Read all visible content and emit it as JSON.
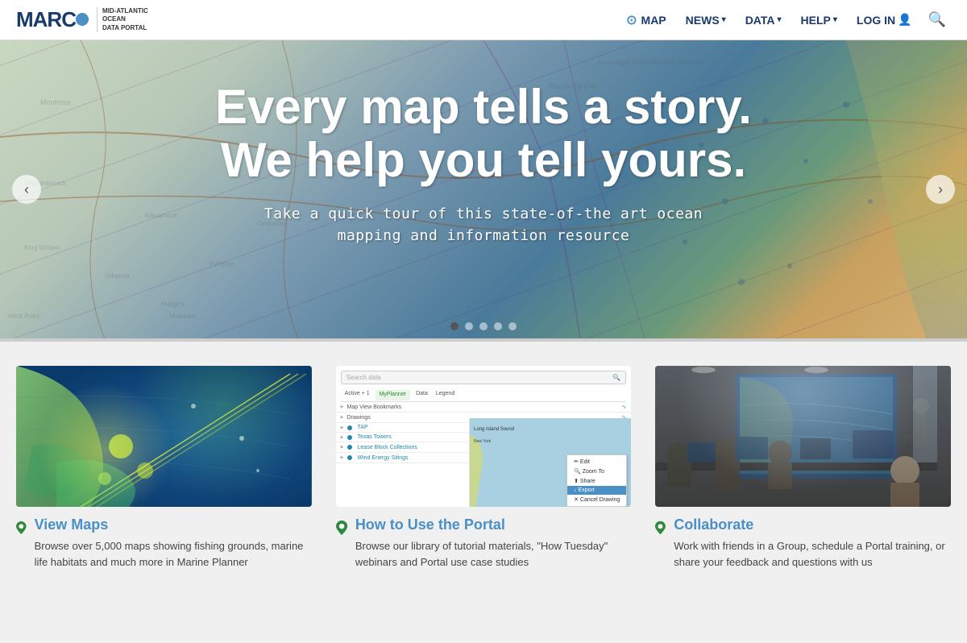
{
  "header": {
    "logo": {
      "name": "MARCO",
      "subtitle_line1": "Mid-Atlantic Ocean",
      "subtitle_line2": "Data Portal"
    },
    "nav": {
      "map_label": "MAP",
      "news_label": "NEWS",
      "data_label": "DATA",
      "help_label": "HELP",
      "login_label": "LOG IN"
    }
  },
  "hero": {
    "headline_line1": "Every map tells a story.",
    "headline_line2": "We help you tell yours.",
    "subtext": "Take a quick tour of this state-of-the art ocean\nmapping and information resource",
    "dots": [
      {
        "active": true
      },
      {
        "active": false
      },
      {
        "active": false
      },
      {
        "active": false
      },
      {
        "active": false
      }
    ]
  },
  "features": [
    {
      "title": "View Maps",
      "description": "Browse over 5,000 maps showing fishing grounds, marine life habitats and much more in Marine Planner",
      "type": "map1"
    },
    {
      "title": "How to Use the Portal",
      "description": "Browse our library of tutorial materials, \"How Tuesday\" webinars and Portal use case studies",
      "type": "ui"
    },
    {
      "title": "Collaborate",
      "description": "Work with friends in a Group, schedule a Portal training, or share your feedback and questions with us",
      "type": "photo"
    }
  ],
  "ui_card": {
    "search_placeholder": "Search data",
    "tabs": [
      "Active + 1",
      "MyPlanner",
      "Data",
      "Legend"
    ],
    "list_items": [
      "Map View Bookmarks",
      "Drawings",
      "TAP",
      "Texas Towers",
      "Lease Block Collections",
      "Wind Energy Sitings"
    ],
    "context_menu": [
      "Edit",
      "Zoom To",
      "Share",
      "Export",
      "Cancel Drawing"
    ]
  },
  "colors": {
    "accent_blue": "#4a90c4",
    "dark_blue": "#1a3a6b",
    "pin_green": "#2e8a3e"
  }
}
